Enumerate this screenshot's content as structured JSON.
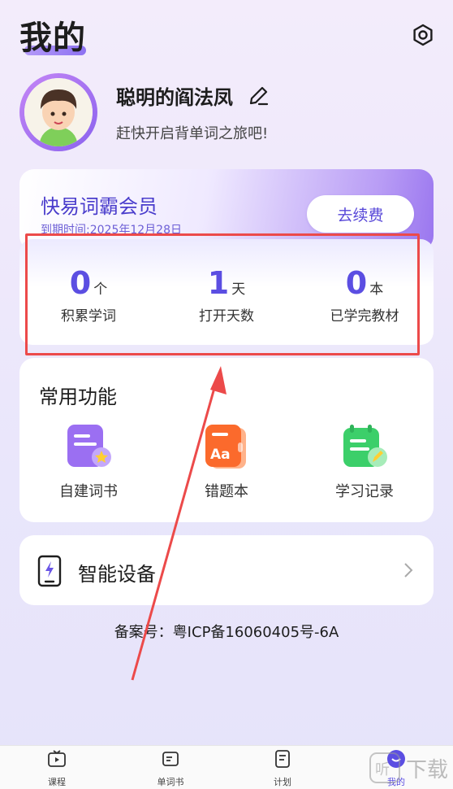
{
  "header": {
    "title": "我的"
  },
  "profile": {
    "username": "聪明的阎法凤",
    "subtitle": "赶快开启背单词之旅吧!"
  },
  "vip": {
    "title": "快易词霸会员",
    "expire": "到期时间:2025年12月28日",
    "renew_label": "去续费"
  },
  "stats": [
    {
      "value": "0",
      "unit": "个",
      "label": "积累学词"
    },
    {
      "value": "1",
      "unit": "天",
      "label": "打开天数"
    },
    {
      "value": "0",
      "unit": "本",
      "label": "已学完教材"
    }
  ],
  "functions": {
    "title": "常用功能",
    "items": [
      {
        "label": "自建词书",
        "icon": "custom-wordbook-icon",
        "color": "#9b6ff2"
      },
      {
        "label": "错题本",
        "icon": "wrong-questions-icon",
        "color": "#fb6a2c"
      },
      {
        "label": "学习记录",
        "icon": "study-record-icon",
        "color": "#3ccf6a"
      }
    ]
  },
  "device": {
    "label": "智能设备"
  },
  "icp": "备案号：粤ICP备16060405号-6A",
  "nav": [
    {
      "label": "课程",
      "icon": "tv-play-icon"
    },
    {
      "label": "单词书",
      "icon": "wordbook-icon"
    },
    {
      "label": "计划",
      "icon": "plan-icon"
    },
    {
      "label": "我的",
      "icon": "profile-icon",
      "active": true
    }
  ],
  "watermark": "下载",
  "colors": {
    "accent": "#5b4ee2",
    "highlight": "#ec4a4a"
  }
}
